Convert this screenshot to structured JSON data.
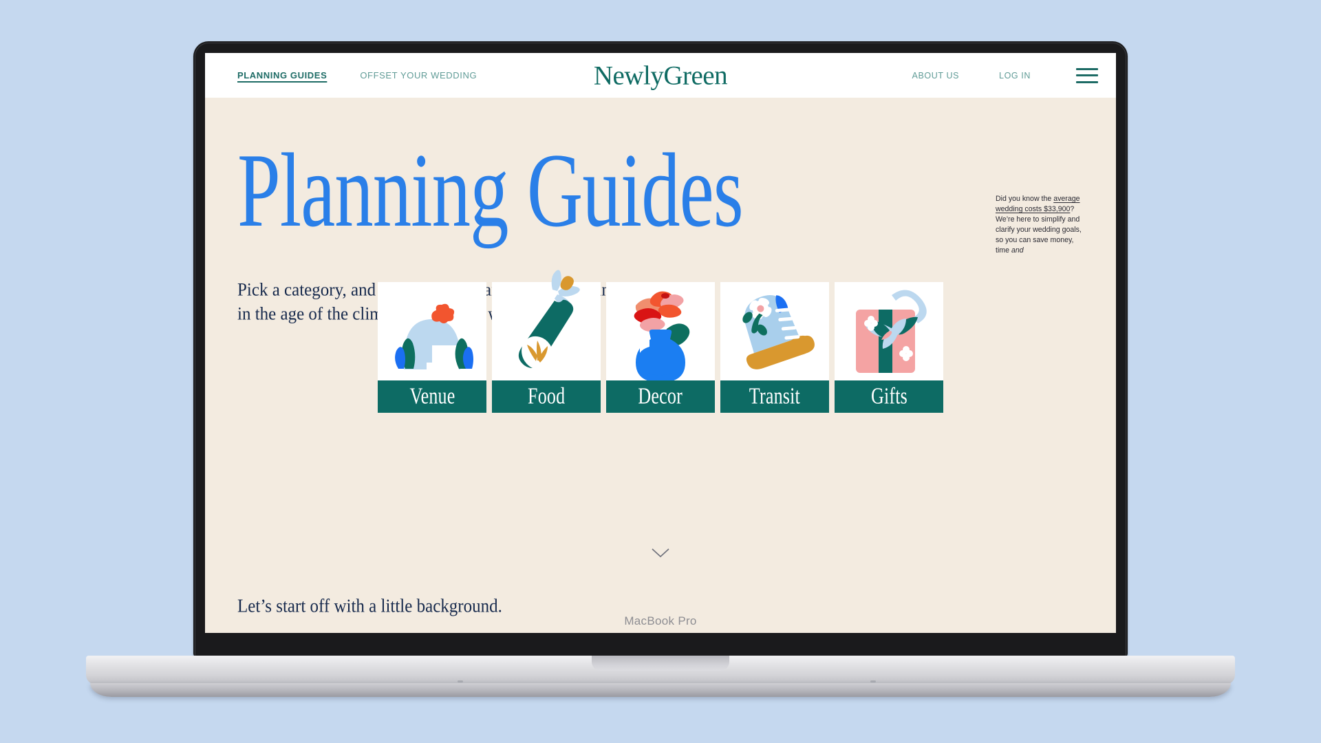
{
  "device": {
    "model_label": "MacBook Pro",
    "background_color": "#c5d8ef"
  },
  "site": {
    "brand": "NewlyGreen",
    "background_color": "#f3ebe0",
    "accent_teal": "#0d6b64",
    "accent_blue": "#2a7fe8",
    "nav": {
      "left_items": [
        {
          "label": "PLANNING GUIDES",
          "active": true
        },
        {
          "label": "OFFSET YOUR WEDDING",
          "active": false
        }
      ],
      "right_items": [
        {
          "label": "ABOUT US"
        },
        {
          "label": "LOG IN"
        }
      ],
      "menu_icon": "hamburger-menu-icon"
    },
    "hero": {
      "title": "Planning Guides",
      "lede_line_1": "Pick a category, and learn how to plan a better wedding",
      "lede_line_2": "in the age of the climate crisis. Yup, we went there."
    },
    "sidenote": {
      "before_link": "Did you know the ",
      "link_text": "average wedding costs $33,900",
      "after_link": "? We’re here to simplify and clarify your wedding goals, so you can save money, time ",
      "italic_tail": "and"
    },
    "cards": [
      {
        "label": "Venue",
        "art": "gazebo-illustration"
      },
      {
        "label": "Food",
        "art": "champagne-bottle-illustration"
      },
      {
        "label": "Decor",
        "art": "flower-vase-illustration"
      },
      {
        "label": "Transit",
        "art": "sneaker-illustration"
      },
      {
        "label": "Gifts",
        "art": "gift-box-illustration"
      }
    ],
    "scroll_hint_icon": "chevron-down-icon",
    "footline": "Let’s start off with a little background."
  }
}
